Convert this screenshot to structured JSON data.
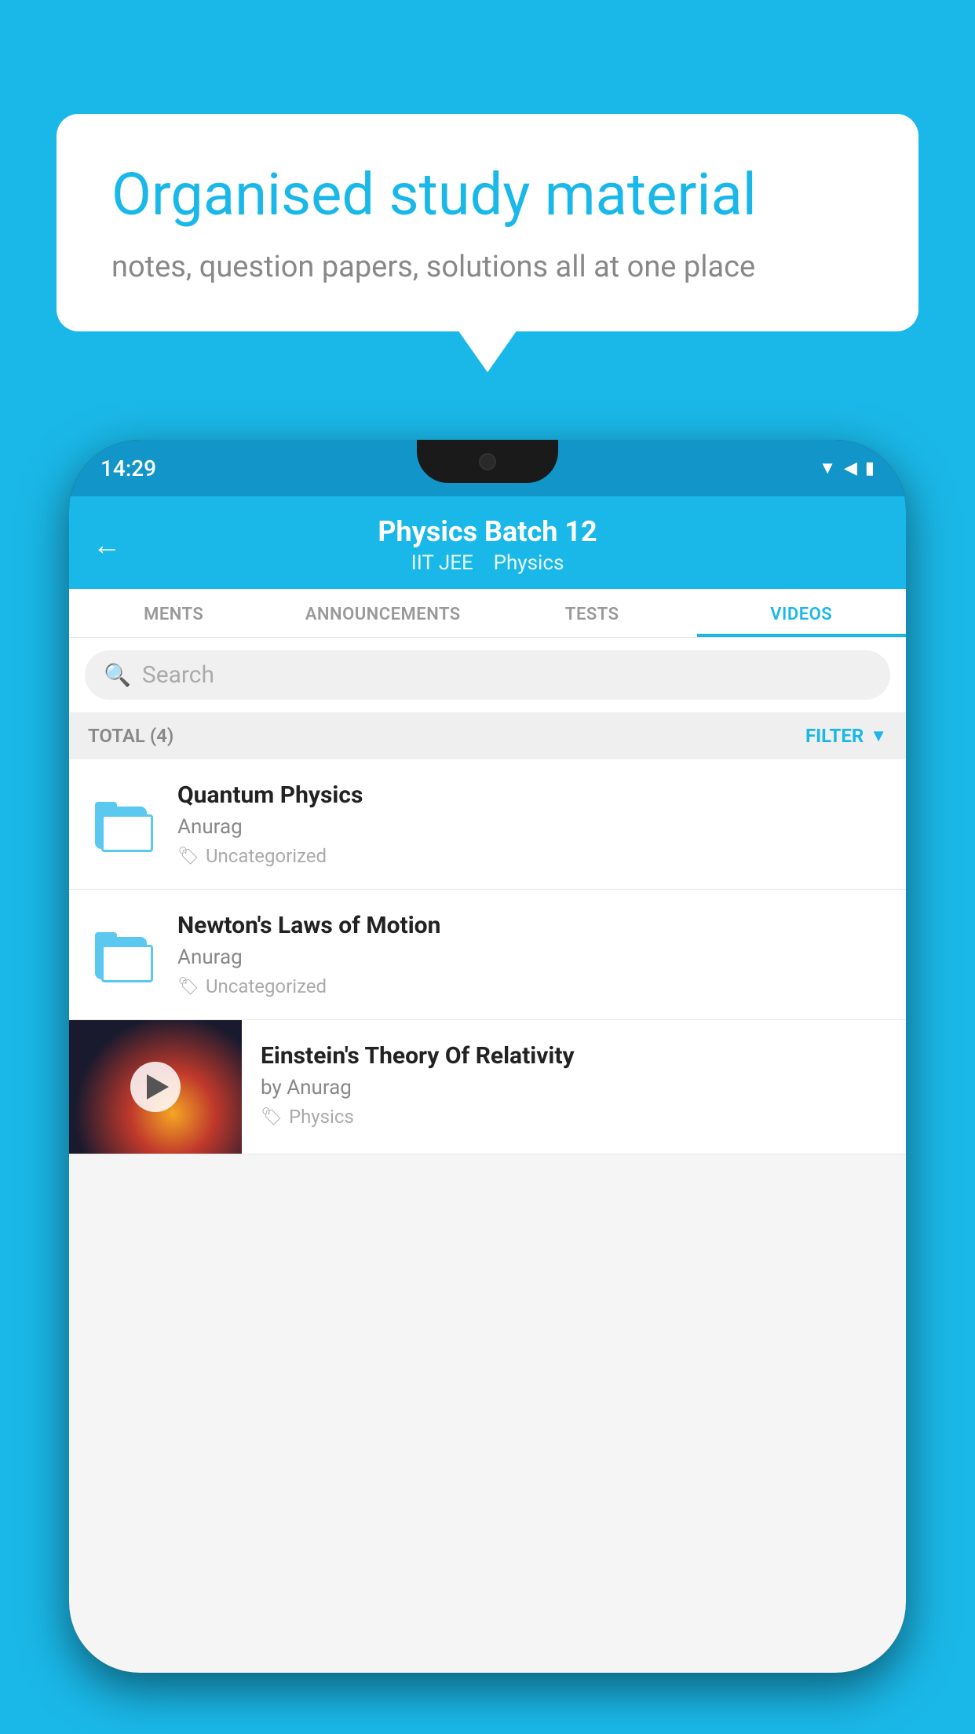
{
  "background_color": "#1ab8e8",
  "bubble": {
    "title": "Organised study material",
    "subtitle": "notes, question papers, solutions all at one place"
  },
  "phone": {
    "status_bar": {
      "time": "14:29"
    },
    "header": {
      "title": "Physics Batch 12",
      "tag1": "IIT JEE",
      "tag2": "Physics",
      "back_label": "←"
    },
    "tabs": [
      {
        "label": "MENTS",
        "active": false
      },
      {
        "label": "ANNOUNCEMENTS",
        "active": false
      },
      {
        "label": "TESTS",
        "active": false
      },
      {
        "label": "VIDEOS",
        "active": true
      }
    ],
    "search": {
      "placeholder": "Search"
    },
    "filter_bar": {
      "total_label": "TOTAL (4)",
      "filter_label": "FILTER"
    },
    "videos": [
      {
        "id": "quantum",
        "title": "Quantum Physics",
        "author": "Anurag",
        "tag": "Uncategorized",
        "has_thumb": false
      },
      {
        "id": "newton",
        "title": "Newton's Laws of Motion",
        "author": "Anurag",
        "tag": "Uncategorized",
        "has_thumb": false
      },
      {
        "id": "einstein",
        "title": "Einstein's Theory Of Relativity",
        "author": "by Anurag",
        "tag": "Physics",
        "has_thumb": true
      }
    ]
  }
}
